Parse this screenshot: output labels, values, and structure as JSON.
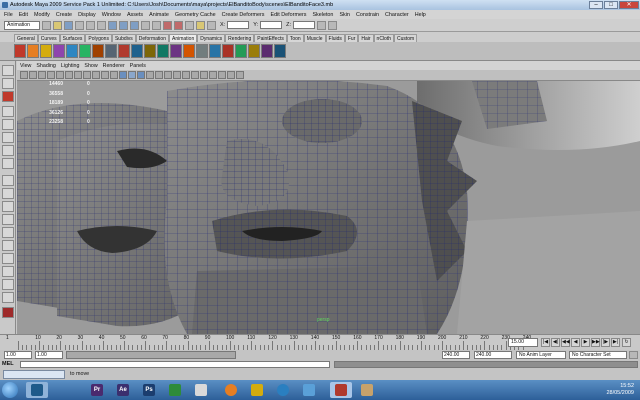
{
  "window": {
    "title": "Autodesk Maya 2009 Service Pack 1 Unlimited: C:\\Users\\Josh\\Documents\\maya\\projects\\ElBanditoBody\\scenes\\ElBanditoFace3.mb",
    "min_label": "–",
    "max_label": "□",
    "close_label": "✕"
  },
  "menubar": [
    "File",
    "Edit",
    "Modify",
    "Create",
    "Display",
    "Window",
    "Assets",
    "Animate",
    "Geometry Cache",
    "Create Deformers",
    "Edit Deformers",
    "Skeleton",
    "Skin",
    "Constrain",
    "Character",
    "Help"
  ],
  "statusline": {
    "mode": "Animation",
    "x_label": "X:",
    "y_label": "Y:",
    "z_label": "Z:"
  },
  "shelf_tabs": [
    "General",
    "Curves",
    "Surfaces",
    "Polygons",
    "Subdivs",
    "Deformation",
    "Animation",
    "Dynamics",
    "Rendering",
    "PaintEffects",
    "Toon",
    "Muscle",
    "Fluids",
    "Fur",
    "Hair",
    "nCloth",
    "Custom"
  ],
  "shelf_active": "Animation",
  "panel_menu": [
    "View",
    "Shading",
    "Lighting",
    "Show",
    "Renderer",
    "Panels"
  ],
  "hud": [
    {
      "label": "",
      "value": "14460",
      "b": "0"
    },
    {
      "label": "",
      "value": "36558",
      "b": "0"
    },
    {
      "label": "",
      "value": "18189",
      "b": "0"
    },
    {
      "label": "",
      "value": "36126",
      "b": "0"
    },
    {
      "label": "",
      "value": "23258",
      "b": "0"
    }
  ],
  "viewport_axis_label": "persp",
  "timeline": {
    "ticks": [
      "10",
      "20",
      "30",
      "40",
      "50",
      "60",
      "70",
      "80",
      "90",
      "100",
      "110",
      "120",
      "130",
      "140",
      "150",
      "160",
      "170",
      "180",
      "190",
      "200",
      "210",
      "220",
      "230",
      "240"
    ],
    "current_frame": "15.00",
    "start_marker": "1"
  },
  "range": {
    "start_a": "1.00",
    "start_b": "1.00",
    "end_a": "240.00",
    "end_b": "240.00",
    "anim_layer": "No Anim Layer",
    "character_set": "No Character Set"
  },
  "mel": {
    "label": "MEL"
  },
  "helpline": {
    "text": "to move"
  },
  "taskbar": {
    "apps": [
      "Ae",
      "Ps",
      "Pr"
    ],
    "time": "15:52",
    "date": "28/05/2009"
  }
}
